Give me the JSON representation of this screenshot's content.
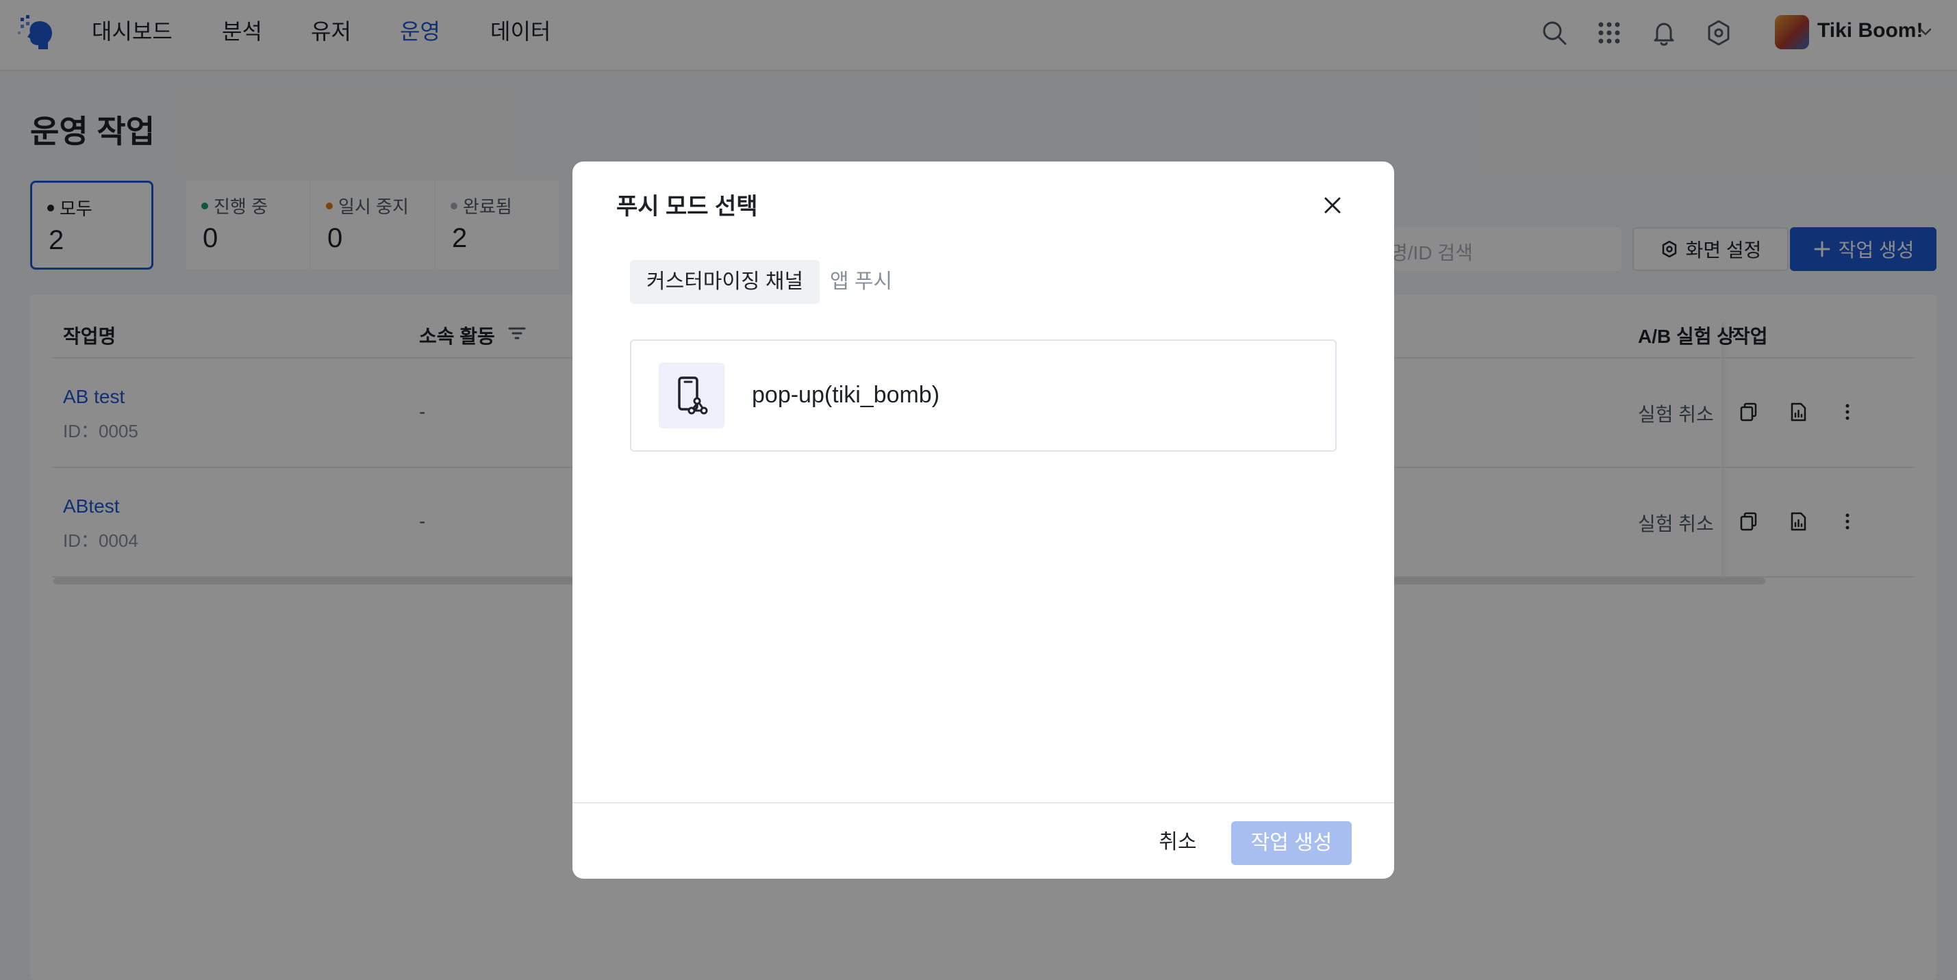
{
  "nav": {
    "items": [
      "대시보드",
      "분석",
      "유저",
      "운영",
      "데이터"
    ],
    "active": "운영"
  },
  "user": {
    "name": "Tiki Boom!"
  },
  "page": {
    "title": "운영 작업"
  },
  "stats": [
    {
      "label": "모두",
      "value": "2",
      "dot_color": "#1f2329"
    },
    {
      "label": "진행 중",
      "value": "0",
      "dot_color": "#1a9b6a"
    },
    {
      "label": "일시 중지",
      "value": "0",
      "dot_color": "#e07a16"
    },
    {
      "label": "완료됨",
      "value": "2",
      "dot_color": "#a9aeb8"
    }
  ],
  "toolbar": {
    "search_placeholder": "명/ID 검색",
    "screen_settings": "화면 설정",
    "create_task": "작업 생성"
  },
  "table": {
    "columns": {
      "name": "작업명",
      "activity": "소속 활동",
      "ab_test": "A/B 실험 상",
      "action": "작업"
    },
    "rows": [
      {
        "name": "AB test",
        "id": "ID：0005",
        "activity": "-",
        "ab_status": "실험 취소"
      },
      {
        "name": "ABtest",
        "id": "ID：0004",
        "activity": "-",
        "ab_status": "실험 취소"
      }
    ]
  },
  "modal": {
    "title": "푸시 모드 선택",
    "tabs": [
      "커스터마이징 채널",
      "앱 푸시"
    ],
    "channel": "pop-up(tiki_bomb)",
    "cancel": "취소",
    "confirm": "작업 생성"
  },
  "colors": {
    "accent": "#1f5ad6",
    "disabled_button": "#a8bef0"
  }
}
